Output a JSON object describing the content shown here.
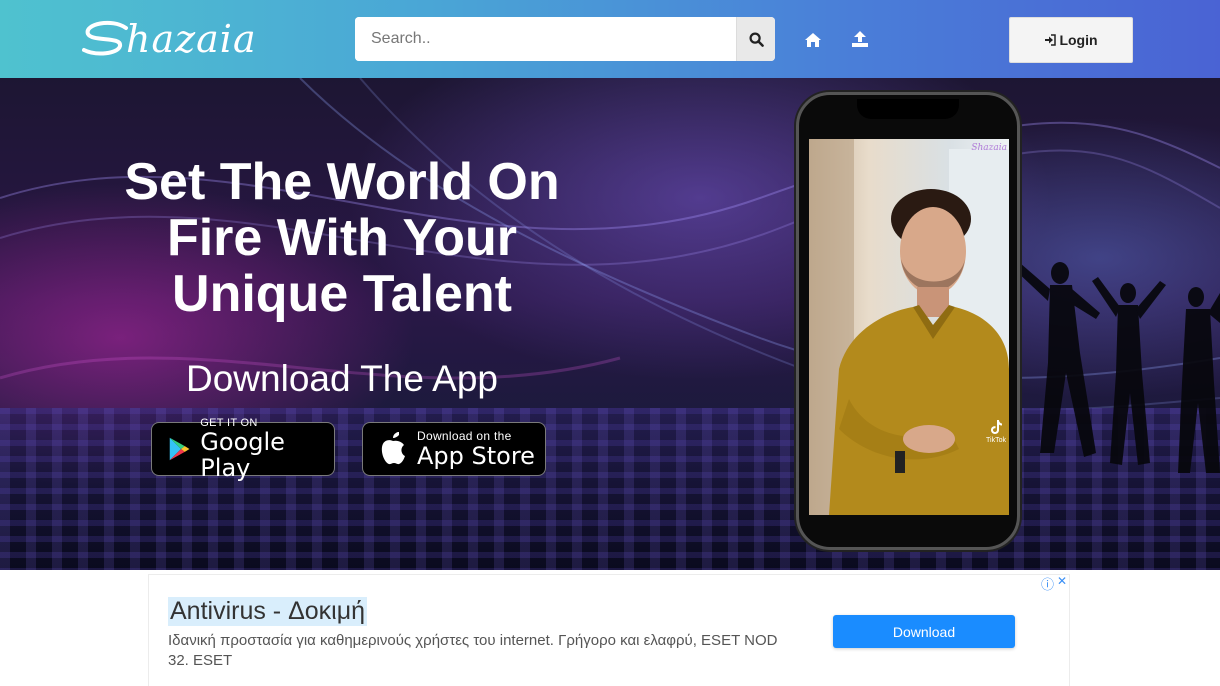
{
  "header": {
    "logo_text": "hazaia",
    "logo_alt": "Shazaia",
    "search_placeholder": "Search..",
    "nav": [
      {
        "icon": "home-icon"
      },
      {
        "icon": "upload-icon"
      }
    ],
    "login_label": "Login",
    "colors": {
      "gradient_start": "#4fc2cf",
      "gradient_end": "#4a63d4"
    }
  },
  "hero": {
    "title": "Set The World On\nFire With Your\nUnique Talent",
    "subtitle": "Download The App",
    "google_play": {
      "small": "GET IT ON",
      "big": "Google Play"
    },
    "app_store": {
      "small": "Download on the",
      "big": "App Store"
    },
    "phone_watermark": "Shazaia",
    "tiktok_label": "TikTok"
  },
  "ad": {
    "title": "Antivirus - Δοκιμή",
    "description": "Ιδανική προστασία για καθημερινούς χρήστες του internet. Γρήγορο και ελαφρύ, ESET NOD 32. ESET",
    "button_label": "Download",
    "info_icon": "ⓘ",
    "close_icon": "✕"
  }
}
